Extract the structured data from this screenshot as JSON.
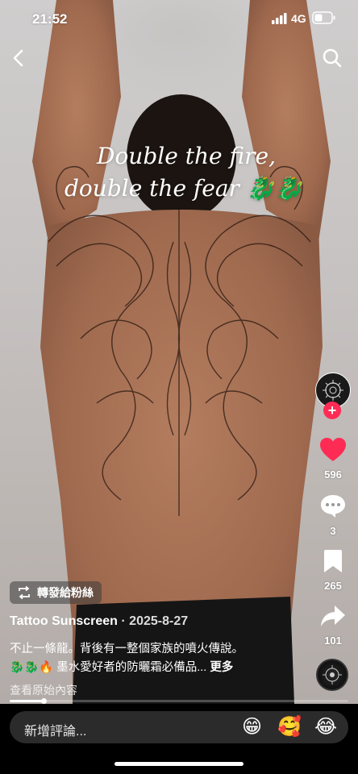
{
  "status_bar": {
    "time": "21:52",
    "network": "4G"
  },
  "video": {
    "caption_line1": "Double the fire,",
    "caption_line2": "double the fear",
    "caption_emoji": "🐉🐉"
  },
  "actions": {
    "likes": "596",
    "comments": "3",
    "saves": "265",
    "shares": "101"
  },
  "repost_label": "轉發給粉絲",
  "author": {
    "name": "Tattoo Sunscreen",
    "separator": " · ",
    "date": "2025-8-27"
  },
  "description": {
    "line1": "不止一條龍。背後有一整個家族的噴火傳說。",
    "line2": "🐉🐉🔥 墨水愛好者的防曬霜必備品...",
    "more": "更多"
  },
  "original_content_link": "查看原始內容",
  "playback": {
    "progress": 0.1
  },
  "comment_bar": {
    "placeholder": "新增評論...",
    "quick_emojis": [
      "😁",
      "🥰",
      "😂"
    ]
  },
  "colors": {
    "like_red": "#fe2c55",
    "follow_red": "#fe2c55"
  }
}
